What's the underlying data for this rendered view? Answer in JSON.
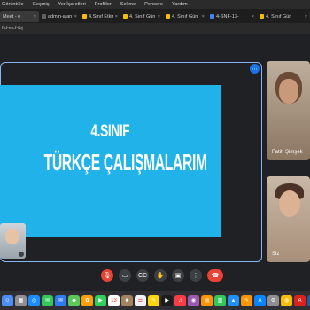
{
  "menubar": {
    "items": [
      "Görüntüle",
      "Geçmiş",
      "Yer İşaretleri",
      "Profiller",
      "Sekme",
      "Pencere",
      "Yardım"
    ]
  },
  "tabs": [
    {
      "label": "Meet - e",
      "active": true,
      "favicon": "#34a853"
    },
    {
      "label": "admin-ajan",
      "active": false,
      "favicon": "#5f6368"
    },
    {
      "label": "4.Sınıf Etkin",
      "active": false,
      "favicon": "#fbbc04"
    },
    {
      "label": "4. Sınıf Gün",
      "active": false,
      "favicon": "#fbbc04"
    },
    {
      "label": "4. Sınıf Gün",
      "active": false,
      "favicon": "#fbbc04"
    },
    {
      "label": "4-SNF-13-",
      "active": false,
      "favicon": "#4285f4"
    },
    {
      "label": "4. Sınıf Gün",
      "active": false,
      "favicon": "#fbbc04"
    }
  ],
  "address": {
    "fragment": "ffd-ejcf-ibj"
  },
  "presentation": {
    "line1": "4.SINIF",
    "line2": "TÜRKÇE ÇALIŞMALARIM",
    "bg": "#21b2ea"
  },
  "participants": {
    "fatih": {
      "name": "Fatih Şimşek"
    },
    "siz": {
      "name": "Siz"
    }
  },
  "controls": [
    {
      "name": "mic-off-icon",
      "glyph": "🎙",
      "red": true
    },
    {
      "name": "camera-icon",
      "glyph": "▭",
      "red": false
    },
    {
      "name": "captions-icon",
      "glyph": "CC",
      "red": false
    },
    {
      "name": "raise-hand-icon",
      "glyph": "✋",
      "red": false
    },
    {
      "name": "present-icon",
      "glyph": "▣",
      "red": false
    },
    {
      "name": "more-options-icon",
      "glyph": "⋮",
      "red": false
    },
    {
      "name": "end-call-icon",
      "glyph": "☎",
      "red": true,
      "end": true
    }
  ],
  "dock": {
    "apps": [
      {
        "name": "finder-icon",
        "color": "#4c8ef7",
        "glyph": "☺"
      },
      {
        "name": "launchpad-icon",
        "color": "#8e8e93",
        "glyph": "▦"
      },
      {
        "name": "safari-icon",
        "color": "#1a8cff",
        "glyph": "◎"
      },
      {
        "name": "messages-icon",
        "color": "#34c759",
        "glyph": "✉"
      },
      {
        "name": "mail-icon",
        "color": "#2d7cf6",
        "glyph": "✉"
      },
      {
        "name": "maps-icon",
        "color": "#5ac85a",
        "glyph": "◆"
      },
      {
        "name": "photos-icon",
        "color": "#ff9f0a",
        "glyph": "✿"
      },
      {
        "name": "facetime-icon",
        "color": "#30d158",
        "glyph": "▶"
      },
      {
        "name": "calendar-icon",
        "color": "#ffffff",
        "glyph": "13"
      },
      {
        "name": "contacts-icon",
        "color": "#a2845e",
        "glyph": "☻"
      },
      {
        "name": "reminders-icon",
        "color": "#f2f2f7",
        "glyph": "☰"
      },
      {
        "name": "notes-icon",
        "color": "#ffd60a",
        "glyph": "✎"
      },
      {
        "name": "appletv-icon",
        "color": "#1c1c1e",
        "glyph": "▶"
      },
      {
        "name": "music-icon",
        "color": "#fc3c44",
        "glyph": "♫"
      },
      {
        "name": "podcasts-icon",
        "color": "#9b59b6",
        "glyph": "◉"
      },
      {
        "name": "books-icon",
        "color": "#ff9500",
        "glyph": "▤"
      },
      {
        "name": "numbers-icon",
        "color": "#34c759",
        "glyph": "▥"
      },
      {
        "name": "keynote-icon",
        "color": "#1e90ff",
        "glyph": "▲"
      },
      {
        "name": "pages-icon",
        "color": "#ff9500",
        "glyph": "✎"
      },
      {
        "name": "appstore-icon",
        "color": "#0a84ff",
        "glyph": "A"
      },
      {
        "name": "settings-icon",
        "color": "#8e8e93",
        "glyph": "⚙"
      },
      {
        "name": "chrome-icon",
        "color": "#fbbc04",
        "glyph": "◍"
      },
      {
        "name": "acrobat-icon",
        "color": "#d9231d",
        "glyph": "A"
      },
      {
        "name": "word-icon",
        "color": "#2b579a",
        "glyph": "W"
      },
      {
        "name": "excel-icon",
        "color": "#217346",
        "glyph": "X"
      },
      {
        "name": "whatsapp-icon",
        "color": "#25d366",
        "glyph": "✆"
      },
      {
        "name": "teams-icon",
        "color": "#6264a7",
        "glyph": "T"
      },
      {
        "name": "zoom-icon",
        "color": "#2d8cff",
        "glyph": "Z"
      },
      {
        "name": "trash-icon",
        "color": "#9a9aa0",
        "glyph": "🗑"
      }
    ]
  }
}
